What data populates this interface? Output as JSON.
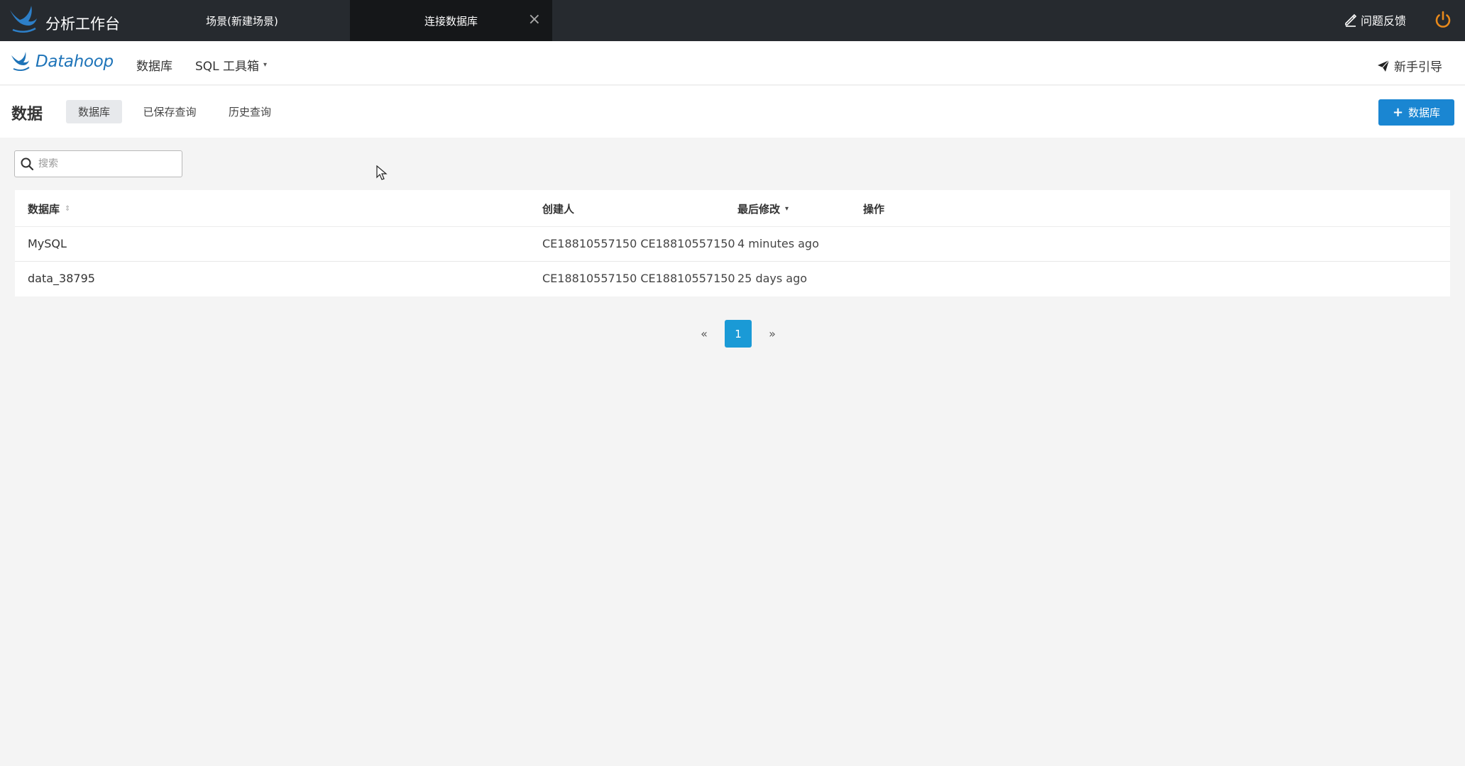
{
  "topbar": {
    "app_title": "分析工作台",
    "tabs": [
      {
        "label": "场景(新建场景)"
      },
      {
        "label": "连接数据库"
      }
    ],
    "close_symbol": "×",
    "feedback_label": "问题反馈",
    "icons": {
      "logo": "bird-logo-icon",
      "feedback": "edit-icon",
      "power": "power-icon"
    },
    "colors": {
      "background": "#262a2f",
      "active_tab": "#151719",
      "power": "#e8891b"
    }
  },
  "subnav": {
    "brand": "Datahoop",
    "links": {
      "database": "数据库",
      "sql_toolbox": "SQL 工具箱"
    },
    "caret": "▾",
    "guide_label": "新手引导",
    "colors": {
      "brand": "#1d73b8"
    }
  },
  "header": {
    "title": "数据",
    "tabs": [
      {
        "label": "数据库"
      },
      {
        "label": "已保存查询"
      },
      {
        "label": "历史查询"
      }
    ],
    "add_button": {
      "plus": "+",
      "label": "数据库"
    },
    "colors": {
      "primary": "#1a86d2"
    }
  },
  "search": {
    "placeholder": "搜索",
    "value": ""
  },
  "table": {
    "columns": [
      {
        "label": "数据库",
        "sort": "⇕"
      },
      {
        "label": "创建人"
      },
      {
        "label": "最后修改",
        "sort": "▾"
      },
      {
        "label": "操作"
      }
    ],
    "rows": [
      {
        "database": "MySQL",
        "creator": "CE18810557150 CE18810557150",
        "modified": "4 minutes ago",
        "action": ""
      },
      {
        "database": "data_38795",
        "creator": "CE18810557150 CE18810557150",
        "modified": "25 days ago",
        "action": ""
      }
    ]
  },
  "pagination": {
    "prev": "«",
    "current": "1",
    "next": "»",
    "colors": {
      "active": "#1a9ad6"
    }
  }
}
